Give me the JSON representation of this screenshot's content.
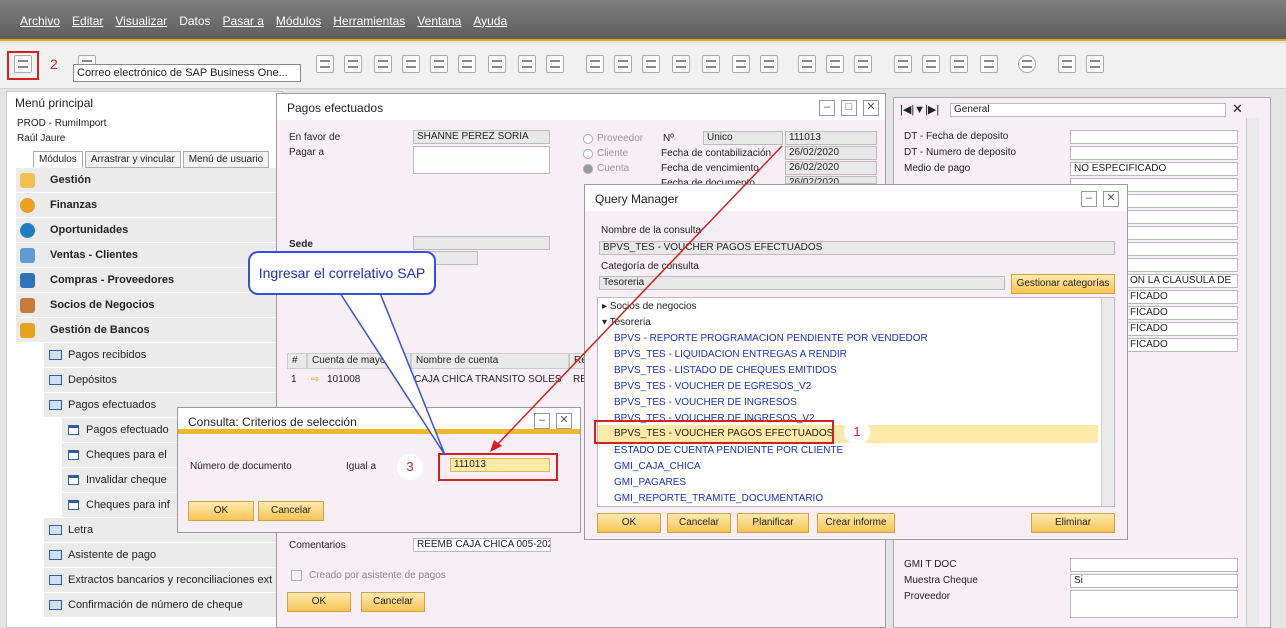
{
  "menu": [
    "Archivo",
    "Editar",
    "Visualizar",
    "Datos",
    "Pasar a",
    "Módulos",
    "Herramientas",
    "Ventana",
    "Ayuda"
  ],
  "annotations": {
    "step1": "1",
    "step2": "2",
    "step3": "3",
    "callout": "Ingresar el correlativo SAP"
  },
  "tooltip": "Correo electrónico de SAP Business One...",
  "main_menu": {
    "title": "Menú principal",
    "db": "PROD - RumiImport",
    "user": "Raúl Jaure",
    "tabs": [
      "Módulos",
      "Arrastrar y vincular",
      "Menú de usuario"
    ],
    "modules": [
      "Gestión",
      "Finanzas",
      "Oportunidades",
      "Ventas - Clientes",
      "Compras - Proveedores",
      "Socios de Negocios",
      "Gestión de Bancos"
    ],
    "bank_items": [
      "Pagos recibidos",
      "Depósitos",
      "Pagos efectuados"
    ],
    "payments_items": [
      "Pagos efectuado",
      "Cheques para el",
      "Invalidar cheque",
      "Cheques para inf"
    ],
    "more_items": [
      "Letra",
      "Asistente de pago",
      "Extractos bancarios y reconciliaciones ext",
      "Confirmación de número de cheque"
    ]
  },
  "pagos": {
    "title": "Pagos efectuados",
    "en_favor_de_label": "En favor de",
    "en_favor_de": "SHANNE PEREZ SORIA",
    "pagar_a_label": "Pagar a",
    "sede_label": "Sede",
    "radios": [
      "Proveedor",
      "Cliente",
      "Cuenta"
    ],
    "no_label": "Nº",
    "serie": "Unico",
    "numero": "111013",
    "fecha_cont_label": "Fecha de contabilización",
    "fecha_cont": "26/02/2020",
    "fecha_venc_label": "Fecha de vencimiento",
    "fecha_venc": "26/02/2020",
    "fecha_doc_label": "Fecha de documento",
    "fecha_doc": "26/02/2020",
    "grid_headers": [
      "#",
      "Cuenta de mayor",
      "Nombre de cuenta",
      "Re"
    ],
    "grid_row": [
      "1",
      "101008",
      "CAJA CHICA TRANSITO SOLES",
      "RE"
    ],
    "comentarios_label": "Comentarios",
    "comentarios": "REEMB CAJA CHICA 005-202",
    "creado_label": "Creado por asistente de pagos",
    "ok": "OK",
    "cancel": "Cancelar"
  },
  "criteria": {
    "title": "Consulta: Criterios de selección",
    "field_label": "Número de documento",
    "op": "Igual a",
    "value": "111013",
    "ok": "OK",
    "cancel": "Cancelar"
  },
  "qm": {
    "title": "Query Manager",
    "name_label": "Nombre de la consulta",
    "name": "BPVS_TES - VOUCHER PAGOS EFECTUADOS",
    "cat_label": "Categoría de consulta",
    "cat": "Tesoreria",
    "manage_btn": "Gestionar categorías",
    "tree": [
      {
        "text": "Socios de negocios",
        "kind": "group"
      },
      {
        "text": "Tesoreria",
        "kind": "group-open"
      },
      {
        "text": "BPVS - REPORTE PROGRAMACION PENDIENTE POR VENDEDOR",
        "kind": "item"
      },
      {
        "text": "BPVS_TES - LIQUIDACION ENTREGAS A RENDIR",
        "kind": "item"
      },
      {
        "text": "BPVS_TES - LISTADO DE CHEQUES EMITIDOS",
        "kind": "item"
      },
      {
        "text": "BPVS_TES - VOUCHER DE EGRESOS_V2",
        "kind": "item"
      },
      {
        "text": "BPVS_TES - VOUCHER DE INGRESOS",
        "kind": "item"
      },
      {
        "text": "BPVS_TES - VOUCHER DE INGRESOS_V2",
        "kind": "item"
      },
      {
        "text": "BPVS_TES - VOUCHER PAGOS EFECTUADOS",
        "kind": "selected"
      },
      {
        "text": "ESTADO DE CUENTA PENDIENTE POR CLIENTE",
        "kind": "item"
      },
      {
        "text": "GMI_CAJA_CHICA",
        "kind": "item"
      },
      {
        "text": "GMI_PAGARES",
        "kind": "item"
      },
      {
        "text": "GMI_REPORTE_TRAMITE_DOCUMENTARIO",
        "kind": "item"
      }
    ],
    "buttons": [
      "OK",
      "Cancelar",
      "Planificar",
      "Crear informe",
      "Eliminar"
    ]
  },
  "udf": {
    "combo": "General",
    "fields": [
      {
        "label": "DT - Fecha de deposito",
        "value": ""
      },
      {
        "label": "DT - Numero de deposito",
        "value": ""
      },
      {
        "label": "Medio de pago",
        "value": "NO ESPECIFICADO"
      }
    ],
    "partial_values": [
      "ON LA CLAUSULA DE",
      "FICADO",
      "FICADO",
      "FICADO",
      "FICADO"
    ],
    "bottom": [
      {
        "label": "GMI T DOC",
        "value": ""
      },
      {
        "label": "Muestra Cheque",
        "value": "Si"
      },
      {
        "label": "Proveedor",
        "value": ""
      }
    ]
  },
  "colors": {
    "accent": "#e6a713",
    "highlight": "#d42020",
    "link": "#1a2fb8"
  }
}
